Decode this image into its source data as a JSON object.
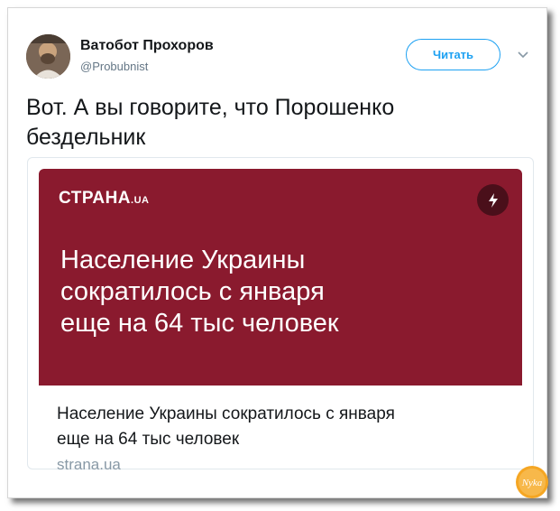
{
  "author": {
    "name": "Ватобот Прохоров",
    "handle": "@Probubnist"
  },
  "follow_button": {
    "label": "Читать"
  },
  "menu_icon": "chevron-down",
  "tweet": {
    "text_line1": "Вот. А вы говорите, что Порошенко",
    "text_line2": "бездельник"
  },
  "card": {
    "image": {
      "logo_main": "СТРАНА",
      "logo_suffix": ".UA",
      "headline_line1": "Население Украины",
      "headline_line2": "сократилось с января",
      "headline_line3": "еще на 64 тыс человек",
      "background_color": "#8a1a2e",
      "badge_icon": "lightning-bolt"
    },
    "title_line1": "Население Украины сократилось с января",
    "title_line2": "еще на 64 тыс человек",
    "domain": "strana.ua"
  },
  "watermark": {
    "text": "Nyka"
  },
  "colors": {
    "accent": "#1da1f2",
    "text_primary": "#14171a",
    "text_secondary": "#657786"
  }
}
